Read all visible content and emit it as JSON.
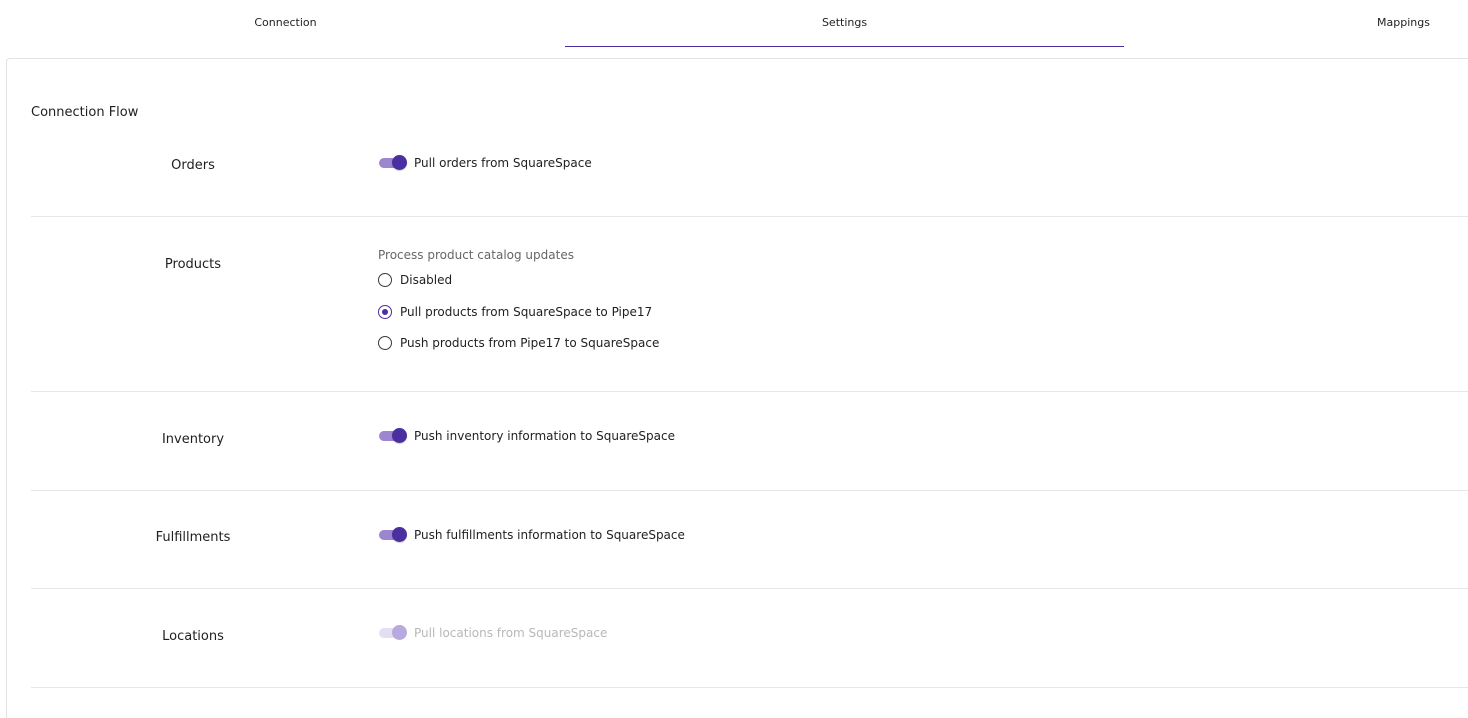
{
  "tabs": {
    "connection": "Connection",
    "settings": "Settings",
    "mappings": "Mappings",
    "active": "settings"
  },
  "section": {
    "title": "Connection Flow"
  },
  "rows": {
    "orders": {
      "label": "Orders",
      "toggle_label": "Pull orders from SquareSpace",
      "enabled": true
    },
    "products": {
      "label": "Products",
      "group_title": "Process product catalog updates",
      "options": [
        {
          "label": "Disabled",
          "selected": false
        },
        {
          "label": "Pull products from SquareSpace to Pipe17",
          "selected": true
        },
        {
          "label": "Push products from Pipe17 to SquareSpace",
          "selected": false
        }
      ]
    },
    "inventory": {
      "label": "Inventory",
      "toggle_label": "Push inventory information to SquareSpace",
      "enabled": true
    },
    "fulfillments": {
      "label": "Fulfillments",
      "toggle_label": "Push fulfillments information to SquareSpace",
      "enabled": true
    },
    "locations": {
      "label": "Locations",
      "toggle_label": "Pull locations from SquareSpace",
      "enabled": true,
      "disabled": true
    }
  },
  "colors": {
    "accent": "#4b2fa0",
    "track": "#9b86cf",
    "disabled_thumb": "#b8a9de",
    "divider": "#e6e6e6"
  }
}
